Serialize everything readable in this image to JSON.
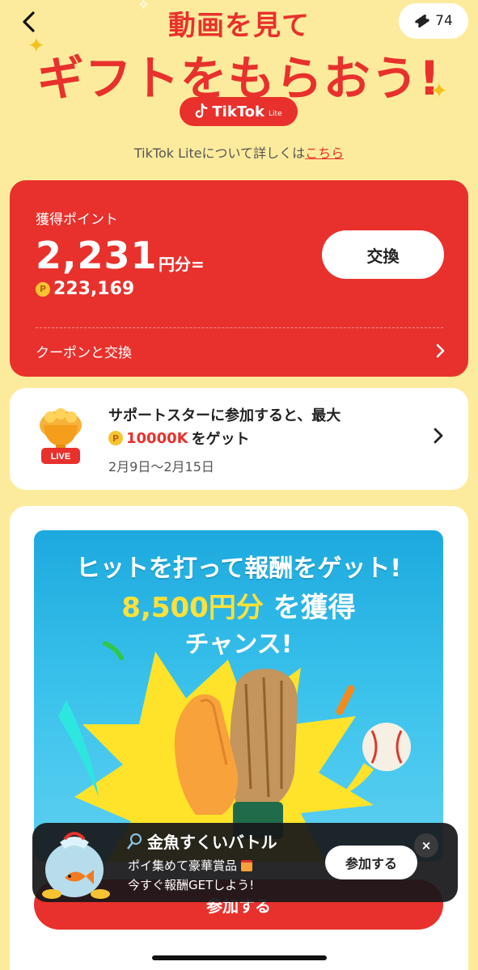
{
  "header": {
    "title_line1": "動画を見て",
    "title_line2": "ギフトをもらおう!",
    "coin_count": "74",
    "logo_text": "TikTok",
    "logo_sub": "Lite",
    "about_text": "TikTok Liteについて詳しくは",
    "about_link": "こちら"
  },
  "points": {
    "label": "獲得ポイント",
    "amount": "2,231",
    "unit": "円分=",
    "coin_symbol": "P",
    "point_value": "223,169",
    "exchange_button": "交換",
    "coupon_row": "クーポンと交換"
  },
  "support_star": {
    "badge": "LIVE",
    "title": "サポートスターに参加すると、最大",
    "reward": "10000K",
    "reward_suffix": "をゲット",
    "dates": "2月9日〜2月15日"
  },
  "campaign": {
    "line1": "ヒットを打って報酬をゲット!",
    "amount": "8,500円分",
    "amount_suffix": "を獲得",
    "line3": "チャンス!",
    "join_button": "参加する"
  },
  "popup": {
    "title": "金魚すくいバトル",
    "line2": "ポイ集めて豪華賞品",
    "line3": "今すぐ報酬GETしよう!",
    "join_button": "参加する",
    "close": "×"
  },
  "colors": {
    "background": "#FDEB9D",
    "brand_red": "#E8312C",
    "banner_blue": "#1DA9DE",
    "highlight_yellow": "#FFE13A"
  }
}
